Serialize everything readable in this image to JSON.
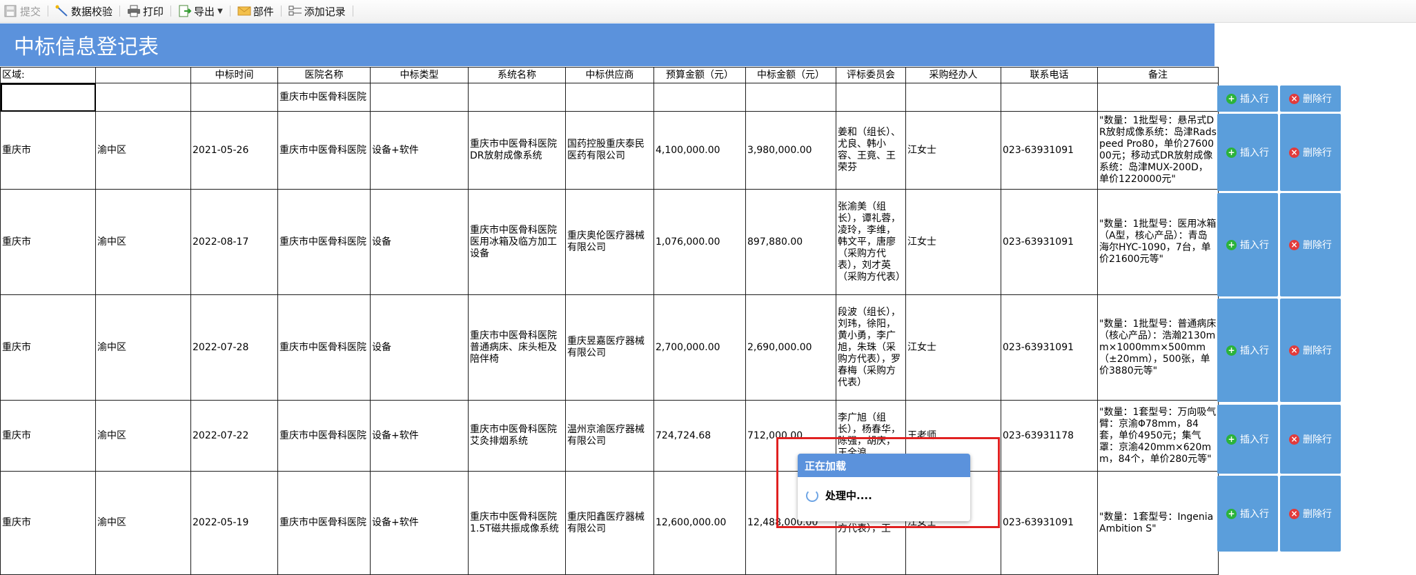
{
  "toolbar": {
    "submit": "提交",
    "validate": "数据校验",
    "print": "打印",
    "export": "导出",
    "mail": "部件",
    "add_record": "添加记录"
  },
  "title": "中标信息登记表",
  "table": {
    "headers": [
      "区域:",
      "",
      "中标时间",
      "医院名称",
      "中标类型",
      "系统名称",
      "中标供应商",
      "预算金额（元）",
      "中标金额（元）",
      "评标委员会",
      "采购经办人",
      "联系电话",
      "备注"
    ],
    "first_row": [
      "",
      "",
      "",
      "重庆市中医骨科医院",
      "",
      "",
      "",
      "",
      "",
      "",
      "",
      "",
      ""
    ],
    "rows": [
      [
        "重庆市",
        "渝中区",
        "2021-05-26",
        "重庆市中医骨科医院",
        "设备+软件",
        "重庆市中医骨科医院DR放射成像系统",
        "国药控股重庆泰民医药有限公司",
        "4,100,000.00",
        "3,980,000.00",
        "姜和（组长）、尤良、韩小容、王竟、王荣芬",
        "江女士",
        "023-63931091",
        "\"数量：1批型号：悬吊式DR放射成像系统：岛津Radspeed Pro80，单价2760000元；移动式DR放射成像系统：岛津MUX-200D，单价1220000元\""
      ],
      [
        "重庆市",
        "渝中区",
        "2022-08-17",
        "重庆市中医骨科医院",
        "设备",
        "重庆市中医骨科医院医用冰箱及临方加工设备",
        "重庆奥伦医疗器械有限公司",
        "1,076,000.00",
        "897,880.00",
        "张渝美（组长），谭礼蓉，凌玲，李维，韩文平，唐廖（采购方代表），刘才英（采购方代表）",
        "江女士",
        "023-63931091",
        "\"数量：1批型号：医用冰箱（A型，核心产品）：青岛海尔HYC-1090，7台，单价21600元等\""
      ],
      [
        "重庆市",
        "渝中区",
        "2022-07-28",
        "重庆市中医骨科医院",
        "设备",
        "重庆市中医骨科医院普通病床、床头柜及陪伴椅",
        "重庆昱嘉医疗器械有限公司",
        "2,700,000.00",
        "2,690,000.00",
        "段波（组长），刘玮，徐阳，黄小勇，李广旭，朱珠（采购方代表），罗春梅（采购方代表）",
        "江女士",
        "023-63931091",
        "\"数量：1批型号：普通病床（核心产品）：浩瀚2130mm×1000mm×500mm（±20mm），500张，单价3880元等\""
      ],
      [
        "重庆市",
        "渝中区",
        "2022-07-22",
        "重庆市中医骨科医院",
        "设备+软件",
        "重庆市中医骨科医院艾灸排烟系统",
        "温州京渝医疗器械有限公司",
        "724,724.68",
        "712,000.00",
        "李广旭（组长），杨春华，陈强，胡庆，王全浪",
        "王老师",
        "023-63931178",
        "\"数量：1套型号：万向吸气臂：京渝Φ78mm，84套，单价4950元；集气罩：京渝420mm×620mm，84个，单价280元等\""
      ],
      [
        "重庆市",
        "渝中区",
        "2022-05-19",
        "重庆市中医骨科医院",
        "设备+软件",
        "重庆市中医骨科医院1.5T磁共振成像系统",
        "重庆阳鑫医疗器械有限公司",
        "12,600,000.00",
        "12,488,000.00",
        "杨昆鹏（采购方代表），王",
        "江女士",
        "023-63931091",
        "\"数量：1套型号：Ingenia Ambition S\""
      ]
    ]
  },
  "actions": {
    "insert": "插入行",
    "delete": "删除行"
  },
  "loading": {
    "title": "正在加载",
    "message": "处理中...."
  }
}
